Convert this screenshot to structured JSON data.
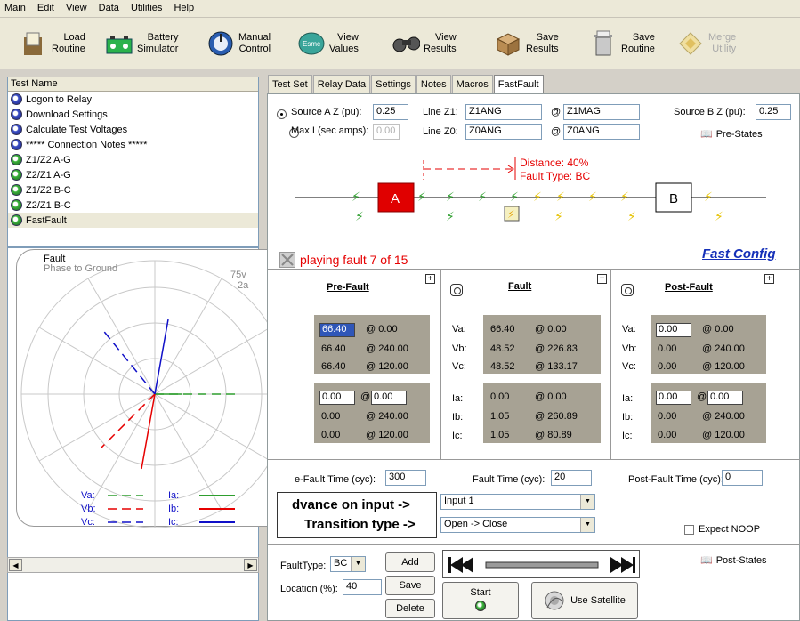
{
  "menu": [
    "Main",
    "Edit",
    "View",
    "Data",
    "Utilities",
    "Help"
  ],
  "toolbar": {
    "load": [
      "Load",
      "Routine"
    ],
    "battery": [
      "Battery",
      "Simulator"
    ],
    "manual": [
      "Manual",
      "Control"
    ],
    "view_values": [
      "View",
      "Values"
    ],
    "view_results": [
      "View",
      "Results"
    ],
    "save_results": [
      "Save",
      "Results"
    ],
    "save_routine": [
      "Save",
      "Routine"
    ],
    "merge": [
      "Merge",
      "Utility"
    ],
    "esmc_text": "Esmc"
  },
  "test_list": {
    "header": "Test Name",
    "items": [
      {
        "label": "Logon to Relay",
        "icon": "blue"
      },
      {
        "label": "Download Settings",
        "icon": "blue"
      },
      {
        "label": "Calculate Test Voltages",
        "icon": "blue"
      },
      {
        "label": "***** Connection Notes *****",
        "icon": "blue"
      },
      {
        "label": "Z1/Z2 A-G",
        "icon": "green"
      },
      {
        "label": "Z2/Z1 A-G",
        "icon": "green"
      },
      {
        "label": "Z1/Z2 B-C",
        "icon": "green"
      },
      {
        "label": "Z2/Z1 B-C",
        "icon": "green"
      },
      {
        "label": "FastFault",
        "icon": "green"
      }
    ],
    "selected_index": 8
  },
  "phasor": {
    "title": "Fault",
    "subtitle": "Phase to Ground",
    "scale_v": "75v",
    "scale_a": "2a",
    "legend": [
      "Va:",
      "Vb:",
      "Vc:",
      "Ia:",
      "Ib:",
      "Ic:"
    ]
  },
  "tabs": [
    "Test Set",
    "Relay Data",
    "Settings",
    "Notes",
    "Macros",
    "FastFault"
  ],
  "source": {
    "source_a_label": "Source A Z (pu):",
    "source_a_value": "0.25",
    "maxi_label": "Max I (sec amps):",
    "maxi_value": "0.00",
    "line_z1_label": "Line Z1:",
    "line_z1_ang": "Z1ANG",
    "line_z1_mag": "Z1MAG",
    "line_z0_label": "Line Z0:",
    "line_z0_ang": "Z0ANG",
    "line_z0_mag": "Z0ANG",
    "at": "@",
    "source_b_label": "Source B Z (pu):",
    "source_b_value": "0.25",
    "prestates": "Pre-States",
    "poststates": "Post-States"
  },
  "diagram": {
    "distance": "Distance: 40%",
    "fault_type": "Fault Type: BC",
    "bus_a": "A",
    "bus_b": "B"
  },
  "status": {
    "playing": "playing fault 7 of 15",
    "fast_config": "Fast Config"
  },
  "prefault": {
    "title": "Pre-Fault",
    "v": [
      [
        "66.40",
        "0.00"
      ],
      [
        "66.40",
        "240.00"
      ],
      [
        "66.40",
        "120.00"
      ]
    ],
    "i": [
      [
        "0.00",
        "0.00"
      ],
      [
        "0.00",
        "240.00"
      ],
      [
        "0.00",
        "120.00"
      ]
    ]
  },
  "fault": {
    "title": "Fault",
    "v": [
      [
        "66.40",
        "0.00"
      ],
      [
        "48.52",
        "226.83"
      ],
      [
        "48.52",
        "133.17"
      ]
    ],
    "i": [
      [
        "0.00",
        "0.00"
      ],
      [
        "1.05",
        "260.89"
      ],
      [
        "1.05",
        "80.89"
      ]
    ]
  },
  "postfault": {
    "title": "Post-Fault",
    "v": [
      [
        "0.00",
        "0.00"
      ],
      [
        "0.00",
        "240.00"
      ],
      [
        "0.00",
        "120.00"
      ]
    ],
    "i": [
      [
        "0.00",
        "0.00"
      ],
      [
        "0.00",
        "240.00"
      ],
      [
        "0.00",
        "120.00"
      ]
    ]
  },
  "labels": {
    "va": "Va:",
    "vb": "Vb:",
    "vc": "Vc:",
    "ia": "Ia:",
    "ib": "Ib:",
    "ic": "Ic:"
  },
  "times": {
    "prefault_label": "e-Fault Time (cyc):",
    "prefault_value": "300",
    "fault_label": "Fault Time (cyc):",
    "fault_value": "20",
    "postfault_label": "Post-Fault Time (cyc):",
    "postfault_value": "0"
  },
  "advance": {
    "advance_label": "dvance on input ->",
    "transition_label": "Transition type ->",
    "input_value": "Input 1",
    "transition_value": "Open -> Close",
    "expect_noop": "Expect NOOP"
  },
  "bottom": {
    "faulttype_label": "FaultType:",
    "faulttype_value": "BC",
    "location_label": "Location (%):",
    "location_value": "40",
    "add": "Add",
    "save": "Save",
    "delete": "Delete",
    "start": "Start",
    "use_satellite": "Use Satellite"
  },
  "colors": {
    "red": "#e60000",
    "green": "#2e9e2e",
    "blue": "#1010c8",
    "panel": "#a7a294",
    "link": "#1530b8"
  }
}
